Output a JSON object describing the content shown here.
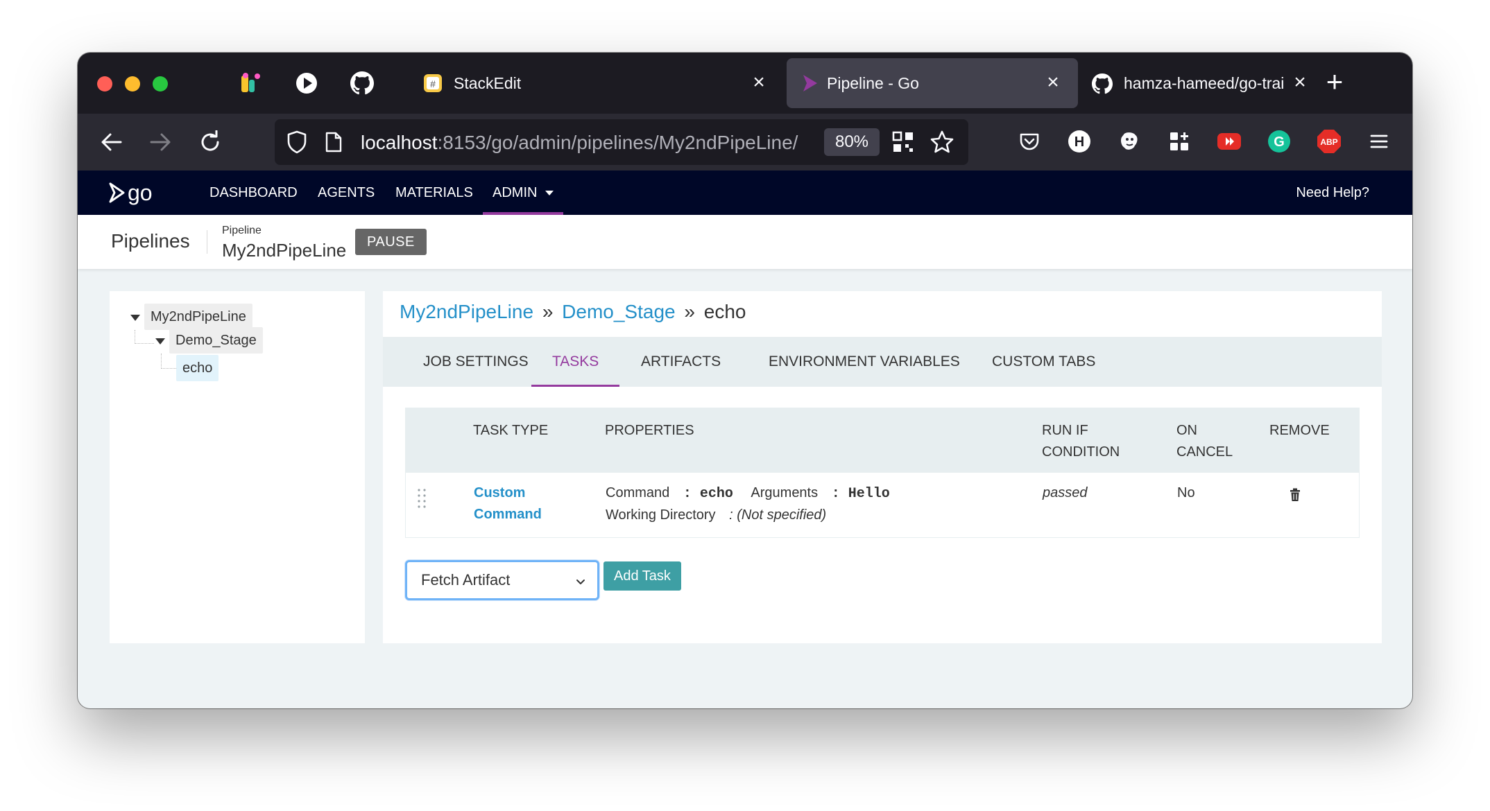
{
  "browser": {
    "tabs": [
      {
        "label": "StackEdit",
        "icon": "stackedit-icon"
      },
      {
        "label": "Pipeline - Go",
        "icon": "gocd-icon"
      },
      {
        "label": "hamza-hameed/go-training at",
        "icon": "github-icon"
      }
    ],
    "url_host": "localhost",
    "url_rest": ":8153/go/admin/pipelines/My2ndPipeLine/",
    "zoom": "80%",
    "extensions": [
      {
        "name": "pocket-icon"
      },
      {
        "name": "h-icon",
        "label": "H"
      },
      {
        "name": "gorilla-icon"
      },
      {
        "name": "grid-plus-icon"
      },
      {
        "name": "youtube-icon"
      },
      {
        "name": "grammarly-icon",
        "label": "G"
      },
      {
        "name": "adblock-icon",
        "label": "ABP"
      }
    ]
  },
  "app": {
    "logo": "go",
    "nav": [
      "DASHBOARD",
      "AGENTS",
      "MATERIALS",
      "ADMIN"
    ],
    "help": "Need Help?",
    "accent": "#943a9e",
    "header_bg": "#000728"
  },
  "page_header": {
    "title": "Pipelines",
    "small_label": "Pipeline",
    "pipeline_name": "My2ndPipeLine",
    "pause": "PAUSE"
  },
  "tree": {
    "pipeline": "My2ndPipeLine",
    "stage": "Demo_Stage",
    "job": "echo"
  },
  "breadcrumb": {
    "pipeline": "My2ndPipeLine",
    "sep": "»",
    "stage": "Demo_Stage",
    "job": "echo"
  },
  "job_tabs": [
    "JOB SETTINGS",
    "TASKS",
    "ARTIFACTS",
    "ENVIRONMENT VARIABLES",
    "CUSTOM TABS"
  ],
  "task_table": {
    "headers": {
      "task_type": "TASK TYPE",
      "properties": "PROPERTIES",
      "run_if_1": "RUN IF",
      "run_if_2": "CONDITION",
      "on_cancel_1": "ON",
      "on_cancel_2": "CANCEL",
      "remove": "REMOVE"
    },
    "rows": [
      {
        "type_1": "Custom",
        "type_2": "Command",
        "command_label": "Command",
        "command_value": ": echo",
        "args_label": "Arguments",
        "args_value": ": Hello",
        "wd_label": "Working Directory",
        "wd_value": ": (Not specified)",
        "run_if": "passed",
        "on_cancel": "No"
      }
    ]
  },
  "add_task": {
    "selected": "Fetch Artifact",
    "button": "Add Task"
  }
}
